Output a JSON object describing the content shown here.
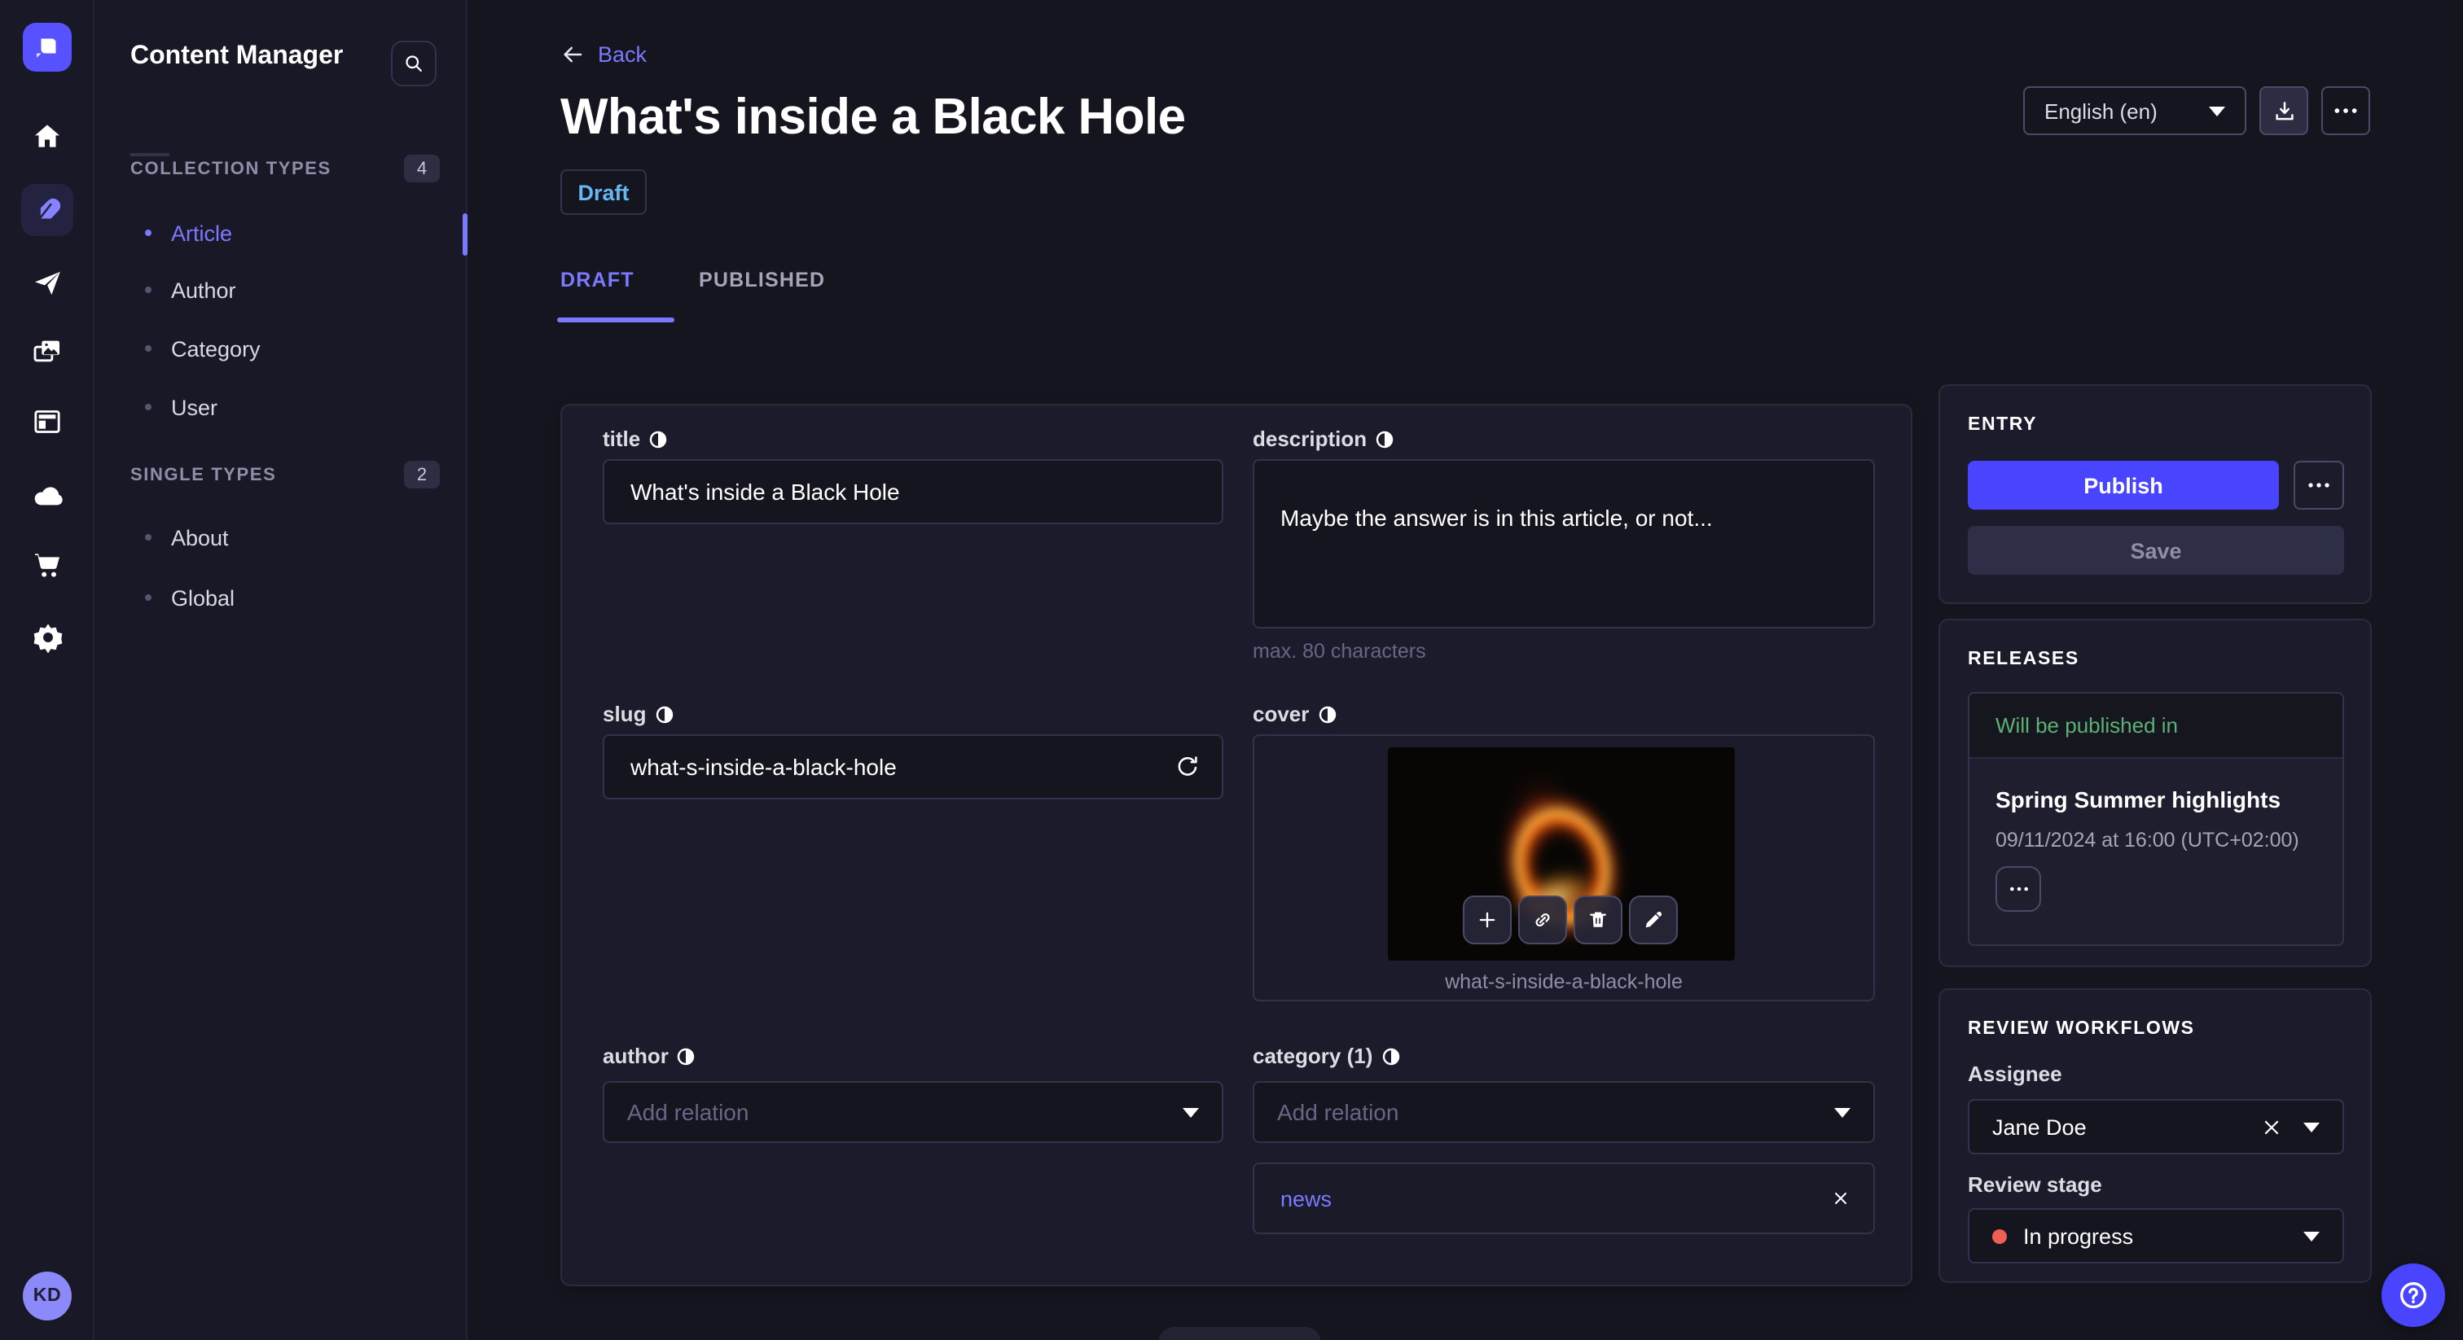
{
  "rail": {
    "logo_icon": "strapi-logo",
    "items": [
      {
        "icon": "home-icon",
        "active": false
      },
      {
        "icon": "feather-icon",
        "active": true
      },
      {
        "icon": "paper-plane-icon",
        "active": false
      },
      {
        "icon": "media-library-icon",
        "active": false
      },
      {
        "icon": "layout-icon",
        "active": false
      },
      {
        "icon": "cloud-icon",
        "active": false
      },
      {
        "icon": "cart-icon",
        "active": false
      },
      {
        "icon": "gear-icon",
        "active": false
      }
    ],
    "avatar_initials": "KD"
  },
  "sidebar": {
    "title": "Content Manager",
    "search_icon": "search-icon",
    "sections": [
      {
        "label": "COLLECTION TYPES",
        "count": "4",
        "items": [
          {
            "label": "Article",
            "active": true
          },
          {
            "label": "Author",
            "active": false
          },
          {
            "label": "Category",
            "active": false
          },
          {
            "label": "User",
            "active": false
          }
        ]
      },
      {
        "label": "SINGLE TYPES",
        "count": "2",
        "items": [
          {
            "label": "About",
            "active": false
          },
          {
            "label": "Global",
            "active": false
          }
        ]
      }
    ]
  },
  "header": {
    "back_label": "Back",
    "title": "What's inside a Black Hole",
    "status_badge": "Draft",
    "tabs": [
      {
        "label": "DRAFT",
        "active": true
      },
      {
        "label": "PUBLISHED",
        "active": false
      }
    ],
    "locale_select": "English (en)",
    "download_icon": "download-icon",
    "more_icon": "ellipsis-icon"
  },
  "form": {
    "title": {
      "label": "title",
      "value": "What's inside a Black Hole"
    },
    "description": {
      "label": "description",
      "value": "Maybe the answer is in this article, or not...",
      "hint": "max. 80 characters"
    },
    "slug": {
      "label": "slug",
      "value": "what-s-inside-a-black-hole",
      "regenerate_icon": "refresh-icon"
    },
    "cover": {
      "label": "cover",
      "caption": "what-s-inside-a-black-hole",
      "actions": [
        {
          "icon": "plus-icon"
        },
        {
          "icon": "link-icon"
        },
        {
          "icon": "trash-icon"
        },
        {
          "icon": "pencil-icon"
        }
      ]
    },
    "author": {
      "label": "author",
      "placeholder": "Add relation"
    },
    "category": {
      "label": "category (1)",
      "placeholder": "Add relation",
      "relations": [
        {
          "label": "news"
        }
      ]
    }
  },
  "entry_panel": {
    "title": "ENTRY",
    "publish_label": "Publish",
    "save_label": "Save"
  },
  "releases_panel": {
    "title": "RELEASES",
    "status": "Will be published in",
    "release_name": "Spring Summer highlights",
    "release_date": "09/11/2024 at 16:00 (UTC+02:00)"
  },
  "review_panel": {
    "title": "REVIEW WORKFLOWS",
    "assignee_label": "Assignee",
    "assignee_value": "Jane Doe",
    "stage_label": "Review stage",
    "stage_value": "In progress"
  },
  "colors": {
    "primary": "#4945ff",
    "link": "#7b79ff",
    "success": "#5cb176",
    "stage_dot": "#ee5e52",
    "draft_badge": "#66b7f1",
    "page_bg": "#15151f",
    "card_bg": "#1b1b2b"
  }
}
